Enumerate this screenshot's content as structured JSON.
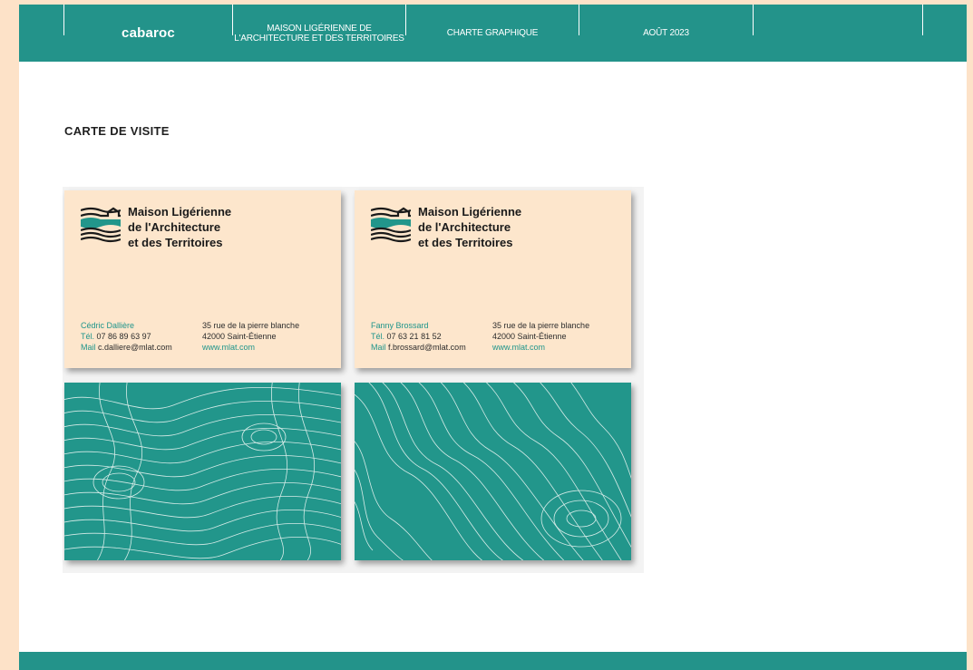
{
  "header": {
    "brand": "cabaroc",
    "org_line1": "MAISON LIGÉRIENNE DE",
    "org_line2": "L'ARCHITECTURE ET DES TERRITOIRES",
    "doc": "CHARTE GRAPHIQUE",
    "date": "AOÛT 2023"
  },
  "section_title": "CARTE DE VISITE",
  "colors": {
    "teal": "#23938a",
    "cream": "#fde6cc",
    "background": "#fde2c8"
  },
  "cards": [
    {
      "logo_icon": "waves-house-logo-icon",
      "logo_line1": "Maison Ligérienne",
      "logo_line2": "de l'Architecture",
      "logo_line3": "et des Territoires",
      "name": "Cédric Dallière",
      "tel_label": "Tél.",
      "tel": "07 86 89 63 97",
      "mail_label": "Mail",
      "mail": "c.dalliere@mlat.com",
      "address1": "35 rue de la pierre blanche",
      "address2": "42000 Saint-Étienne",
      "website": "www.mlat.com"
    },
    {
      "logo_icon": "waves-house-logo-icon",
      "logo_line1": "Maison Ligérienne",
      "logo_line2": "de l'Architecture",
      "logo_line3": "et des Territoires",
      "name": "Fanny Brossard",
      "tel_label": "Tél.",
      "tel": "07 63 21 81 52",
      "mail_label": "Mail",
      "mail": "f.brossard@mlat.com",
      "address1": "35 rue de la pierre blanche",
      "address2": "42000 Saint-Étienne",
      "website": "www.mlat.com"
    }
  ],
  "card_backs": [
    {
      "pattern": "topographic-contour-lines"
    },
    {
      "pattern": "topographic-contour-lines"
    }
  ]
}
